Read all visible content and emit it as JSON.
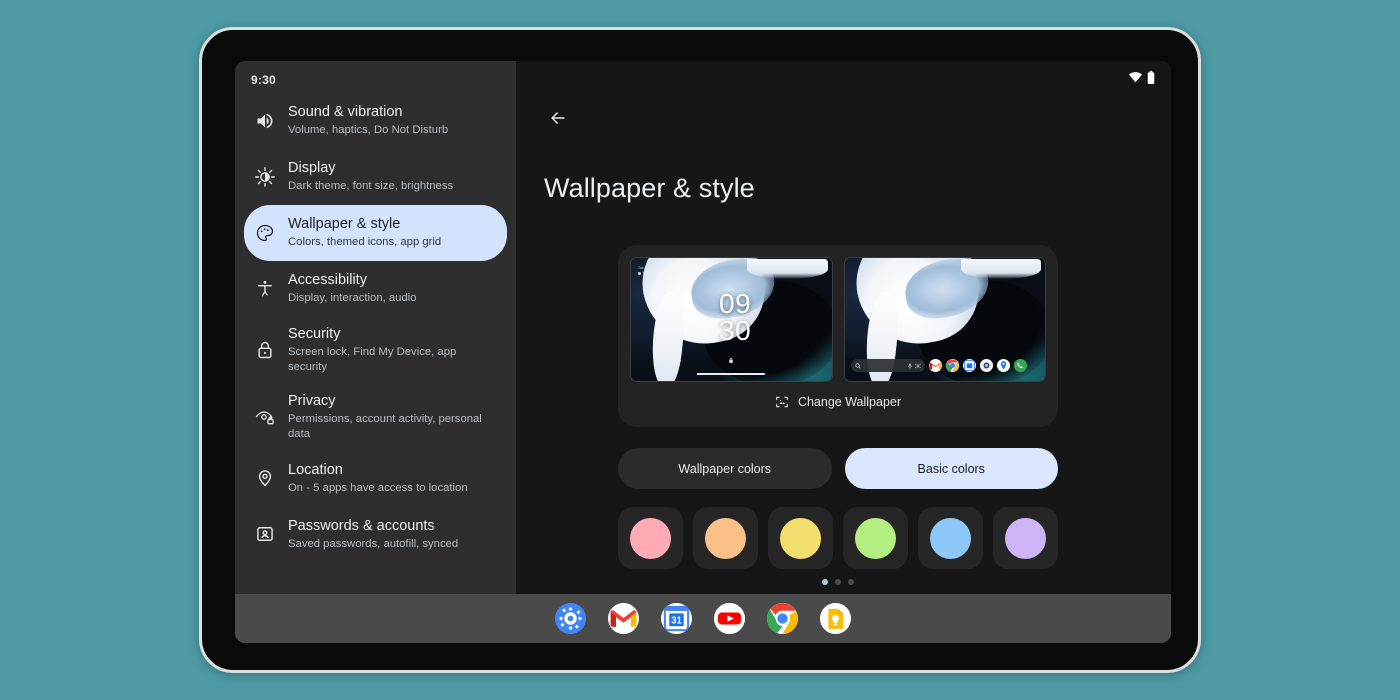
{
  "background_color": "#4d9aa4",
  "device": {
    "bezel_color": "#dcdfe0",
    "frame_color": "#0a0a0a"
  },
  "sidebar": {
    "clock": "9:30",
    "background_color": "#2e2e2e",
    "selected_color": "#d3e3fd",
    "items": [
      {
        "icon": "volume-icon",
        "title": "Sound & vibration",
        "subtitle": "Volume, haptics, Do Not Disturb",
        "selected": false
      },
      {
        "icon": "brightness-icon",
        "title": "Display",
        "subtitle": "Dark theme, font size, brightness",
        "selected": false
      },
      {
        "icon": "palette-icon",
        "title": "Wallpaper & style",
        "subtitle": "Colors, themed icons, app grid",
        "selected": true
      },
      {
        "icon": "accessibility-icon",
        "title": "Accessibility",
        "subtitle": "Display, interaction, audio",
        "selected": false
      },
      {
        "icon": "lock-icon",
        "title": "Security",
        "subtitle": "Screen lock, Find My Device, app security",
        "selected": false
      },
      {
        "icon": "eye-lock-icon",
        "title": "Privacy",
        "subtitle": "Permissions, account activity, personal data",
        "selected": false
      },
      {
        "icon": "location-pin-icon",
        "title": "Location",
        "subtitle": "On - 5 apps have access to location",
        "selected": false
      },
      {
        "icon": "id-card-icon",
        "title": "Passwords & accounts",
        "subtitle": "Saved passwords, autofill, synced",
        "selected": false
      }
    ]
  },
  "main": {
    "background_color": "#161616",
    "status_bar": {
      "wifi_icon": "wifi-icon",
      "battery_icon": "battery-icon"
    },
    "back_icon": "back-arrow-icon",
    "title": "Wallpaper & style",
    "preview": {
      "lock_screen": {
        "time_hours": "09",
        "time_minutes": "30",
        "date_line": "Tue, Jul 19",
        "weather_line": "68°F",
        "lock_icon": "lock-icon",
        "label": "lock-screen-preview"
      },
      "home_screen": {
        "label": "home-screen-preview",
        "search_icon": "search-icon",
        "mic_icon": "microphone-icon",
        "lens_icon": "lens-icon",
        "dock_apps": [
          "gmail-icon",
          "chrome-icon",
          "calendar-icon",
          "camera-icon",
          "maps-icon",
          "phone-icon"
        ]
      },
      "change_wallpaper_label": "Change Wallpaper",
      "change_wallpaper_icon": "image-crop-icon"
    },
    "color_tabs": [
      {
        "label": "Wallpaper colors",
        "active": false
      },
      {
        "label": "Basic colors",
        "active": true
      }
    ],
    "swatches": [
      {
        "name": "pink",
        "color": "#ffaab4"
      },
      {
        "name": "orange",
        "color": "#fbc087"
      },
      {
        "name": "yellow",
        "color": "#f3df6d"
      },
      {
        "name": "green",
        "color": "#b3ee81"
      },
      {
        "name": "blue",
        "color": "#8ec8f8"
      },
      {
        "name": "purple",
        "color": "#cdb4f5"
      }
    ],
    "page_dots": {
      "count": 3,
      "active_index": 0
    }
  },
  "taskbar": {
    "background_color": "#4a4a4a",
    "apps": [
      "settings-icon",
      "gmail-icon",
      "calendar-icon",
      "youtube-icon",
      "chrome-icon",
      "keep-icon"
    ]
  }
}
